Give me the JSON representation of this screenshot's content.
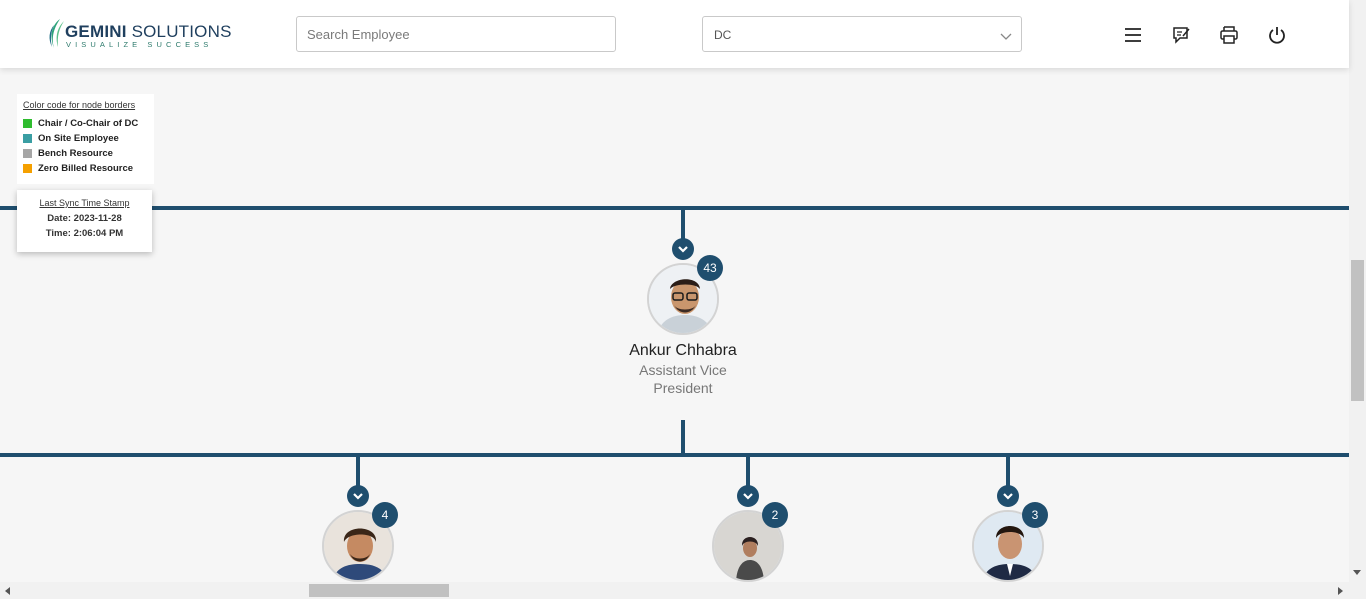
{
  "header": {
    "logo": {
      "brand_bold": "GEMINI",
      "brand_rest": " SOLUTIONS",
      "tagline": "VISUALIZE SUCCESS"
    },
    "search": {
      "placeholder": "Search Employee",
      "value": ""
    },
    "dropdown": {
      "selected": "DC"
    },
    "icons": [
      "menu-icon",
      "feedback-icon",
      "print-icon",
      "power-icon"
    ]
  },
  "legend": {
    "title": "Color code for node borders",
    "items": [
      {
        "label": "Chair / Co-Chair of DC",
        "color": "#2ebc2e"
      },
      {
        "label": "On Site Employee",
        "color": "#3a9ea3"
      },
      {
        "label": "Bench Resource",
        "color": "#a6a6a6"
      },
      {
        "label": "Zero Billed Resource",
        "color": "#f5a000"
      }
    ]
  },
  "sync": {
    "title": "Last Sync Time Stamp",
    "date": "Date: 2023-11-28",
    "time": "Time: 2:06:04 PM"
  },
  "tree": {
    "root": {
      "name": "Ankur Chhabra",
      "title_line1": "Assistant Vice",
      "title_line2": "President",
      "count": "43"
    },
    "children": [
      {
        "count": "4"
      },
      {
        "count": "2"
      },
      {
        "count": "3"
      }
    ]
  },
  "colors": {
    "connector": "#1f4e6e",
    "header_bg": "#ffffff",
    "canvas_bg": "#f6f6f6"
  }
}
